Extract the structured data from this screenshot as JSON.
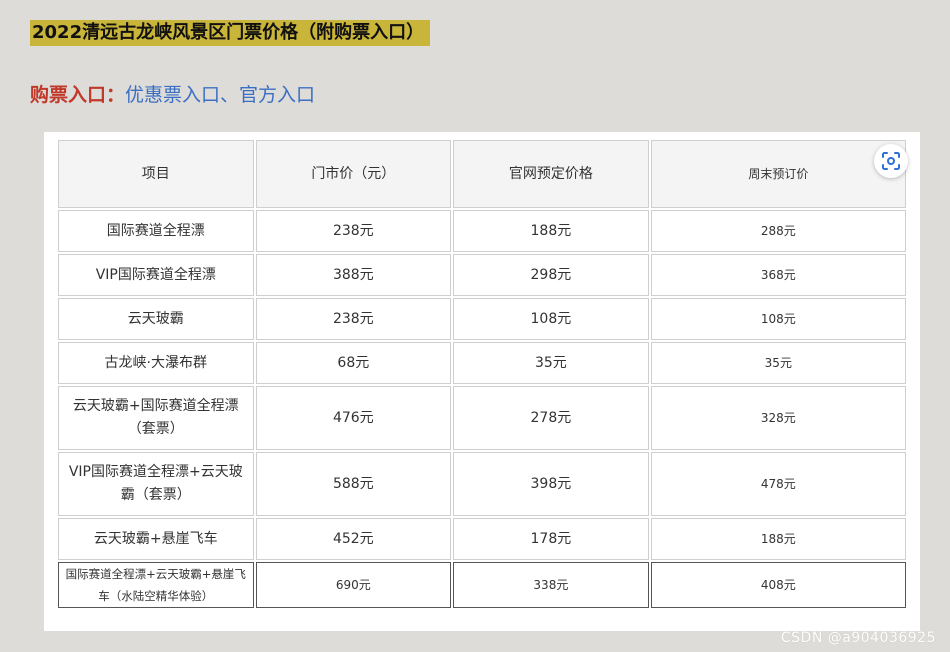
{
  "article": {
    "title": "2022清远古龙峡风景区门票价格（附购票入口）",
    "entry_label": "购票入口：",
    "links": [
      "优惠票入口",
      "官方入口"
    ],
    "link_separator": "、"
  },
  "table": {
    "headers": [
      "项目",
      "门市价（元）",
      "官网预定价格",
      "周末预订价"
    ],
    "rows": [
      [
        "国际赛道全程漂",
        "238元",
        "188元",
        "288元"
      ],
      [
        "VIP国际赛道全程漂",
        "388元",
        "298元",
        "368元"
      ],
      [
        "云天玻霸",
        "238元",
        "108元",
        "108元"
      ],
      [
        "古龙峡·大瀑布群",
        "68元",
        "35元",
        "35元"
      ],
      [
        "云天玻霸+国际赛道全程漂（套票）",
        "476元",
        "278元",
        "328元"
      ],
      [
        "VIP国际赛道全程漂+云天玻霸（套票）",
        "588元",
        "398元",
        "478元"
      ],
      [
        "云天玻霸+悬崖飞车",
        "452元",
        "178元",
        "188元"
      ],
      [
        "国际赛道全程漂+云天玻霸+悬崖飞车（水陆空精华体验）",
        "690元",
        "338元",
        "408元"
      ]
    ]
  },
  "icons": {
    "scan": "scan-icon"
  },
  "watermark": "CSDN @a904036925"
}
